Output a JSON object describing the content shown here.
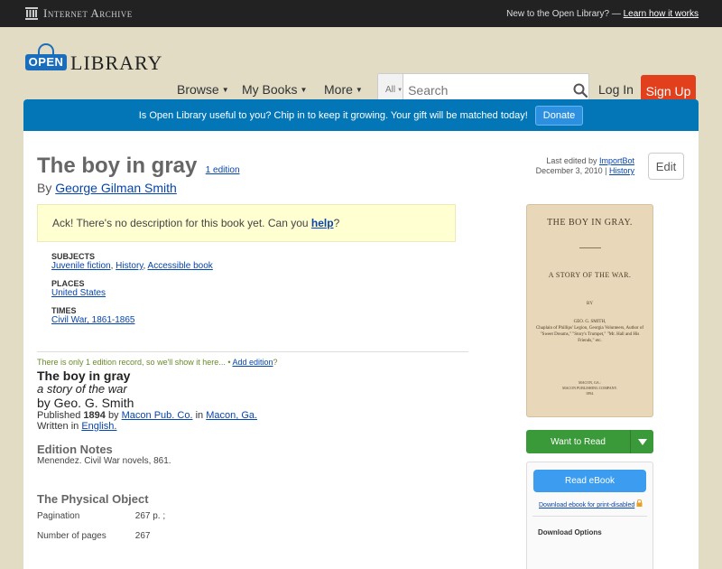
{
  "topbar": {
    "brand": "Internet Archive",
    "prompt": "New to the Open Library? —",
    "learn_link": "Learn how it works"
  },
  "header": {
    "logo_sign": "OPEN",
    "logo_word": "LIBRARY",
    "nav": [
      {
        "label": "Browse"
      },
      {
        "label": "My Books"
      },
      {
        "label": "More"
      }
    ],
    "search_scope": "All",
    "search_placeholder": "Search",
    "login": "Log In",
    "signup": "Sign Up"
  },
  "donate_banner": {
    "text": "Is Open Library useful to you? Chip in to keep it growing. Your gift will be matched today!",
    "button": "Donate"
  },
  "work": {
    "title": "The boy in gray",
    "edition_count": "1 edition",
    "by": "By",
    "author": "George Gilman Smith",
    "last_edited_prefix": "Last edited by",
    "last_edited_by": "ImportBot",
    "last_edited_date": "December 3, 2010 |",
    "history": "History",
    "edit": "Edit"
  },
  "description": {
    "text": "Ack! There's no description for this book yet. Can you",
    "help": "help",
    "end": "?"
  },
  "facets": {
    "subjects_label": "SUBJECTS",
    "subjects": [
      "Juvenile fiction",
      "History",
      "Accessible book"
    ],
    "places_label": "PLACES",
    "places": [
      "United States"
    ],
    "times_label": "TIMES",
    "times": [
      "Civil War, 1861-1865"
    ]
  },
  "edition_note": {
    "text": "There is only 1 edition record, so we'll show it here... •",
    "add": "Add edition",
    "end": "?"
  },
  "edition": {
    "title": "The boy in gray",
    "subtitle": "a story of the war",
    "by": "by Geo. G. Smith",
    "published_prefix": "Published",
    "year": "1894",
    "by_word": "by",
    "publisher": "Macon Pub. Co.",
    "in_word": "in",
    "place": "Macon, Ga.",
    "written_prefix": "Written in",
    "language": "English."
  },
  "edition_notes": {
    "heading": "Edition Notes",
    "text": "Menendez. Civil War novels, 861."
  },
  "physical": {
    "heading": "The Physical Object",
    "rows": [
      {
        "key": "Pagination",
        "value": "267 p. ;"
      },
      {
        "key": "Number of pages",
        "value": "267"
      }
    ]
  },
  "cover": {
    "title": "THE BOY IN GRAY.",
    "subtitle": "A STORY OF THE WAR.",
    "by": "BY",
    "author": "GEO. G. SMITH,",
    "author_note": "Chaplain of Phillips' Legion, Georgia Volunteers, Author of \"Sweet Dreams,\" \"Story's Trumpet,\" \"Mr. Hall and His Friends,\" etc.",
    "pub_place": "MACON, GA.:",
    "publisher": "MACON PUBLISHING COMPANY.",
    "pub_year": "1894."
  },
  "sidebar": {
    "want_to_read": "Want to Read",
    "read_ebook": "Read eBook",
    "download_disabled": "Download ebook for print-disabled",
    "download_options": "Download Options"
  }
}
